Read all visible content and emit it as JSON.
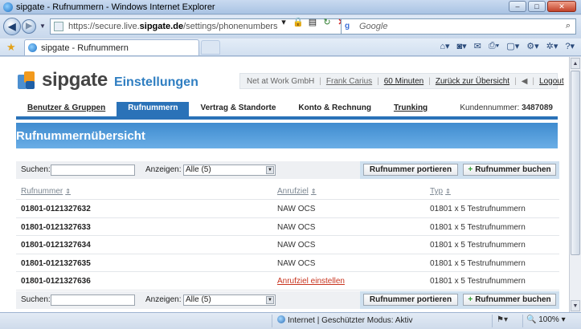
{
  "window": {
    "title": "sipgate - Rufnummern - Windows Internet Explorer",
    "minimize": "–",
    "maximize": "□",
    "close": "✕"
  },
  "browser": {
    "url_prefix": "https://secure.live.",
    "url_domain": "sipgate.de",
    "url_path": "/settings/phonenumbers",
    "search_placeholder": "Google",
    "tab_title": "sipgate - Rufnummern",
    "status_zone": "Internet | Geschützter Modus: Aktiv",
    "zoom": "100%"
  },
  "header": {
    "brand": "sipgate",
    "section": "Einstellungen",
    "company": "Net at Work GmbH",
    "user": "Frank Carius",
    "minutes": "60 Minuten",
    "back_link": "Zurück zur Übersicht",
    "logout": "Logout"
  },
  "nav": {
    "items": [
      {
        "label": "Benutzer & Gruppen"
      },
      {
        "label": "Rufnummern"
      },
      {
        "label": "Vertrag & Standorte"
      },
      {
        "label": "Konto & Rechnung"
      },
      {
        "label": "Trunking"
      }
    ],
    "customer_label": "Kundennummer:",
    "customer_number": "3487089"
  },
  "page": {
    "title": "Rufnummernübersicht"
  },
  "filter": {
    "search_label": "Suchen:",
    "search_value": "",
    "show_label": "Anzeigen:",
    "show_value": "Alle (5)",
    "port_button": "Rufnummer portieren",
    "book_button": "Rufnummer buchen"
  },
  "table": {
    "columns": [
      "Rufnummer",
      "Anrufziel",
      "Typ"
    ],
    "rows": [
      {
        "number": "01801-0121327632",
        "target": "NAW OCS",
        "type": "01801 x 5 Testrufnummern"
      },
      {
        "number": "01801-0121327633",
        "target": "NAW OCS",
        "type": "01801 x 5 Testrufnummern"
      },
      {
        "number": "01801-0121327634",
        "target": "NAW OCS",
        "type": "01801 x 5 Testrufnummern"
      },
      {
        "number": "01801-0121327635",
        "target": "NAW OCS",
        "type": "01801 x 5 Testrufnummern"
      },
      {
        "number": "01801-0121327636",
        "target": "Anrufziel einstellen",
        "type": "01801 x 5 Testrufnummern"
      }
    ]
  },
  "colors": {
    "accent": "#2a72b8",
    "banner": "#4a95d6",
    "link_red": "#c8341f",
    "logo_orange": "#f29a1d"
  }
}
